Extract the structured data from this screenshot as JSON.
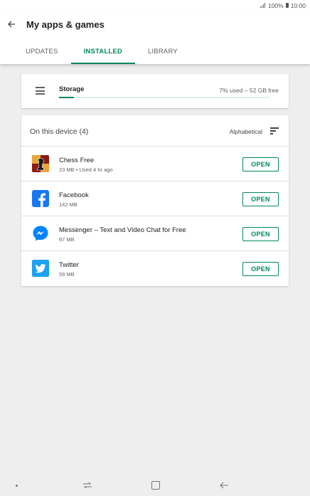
{
  "status_bar": {
    "battery": "100%",
    "time": "10:00"
  },
  "header": {
    "title": "My apps & games",
    "tabs": [
      {
        "label": "UPDATES",
        "active": false
      },
      {
        "label": "INSTALLED",
        "active": true
      },
      {
        "label": "LIBRARY",
        "active": false
      }
    ]
  },
  "storage": {
    "label": "Storage",
    "usage_text": "7% used – 52 GB free",
    "used_fraction": 0.07
  },
  "device": {
    "title": "On this device (4)",
    "sort_label": "Alphabetical",
    "apps": [
      {
        "name": "Chess Free",
        "meta": "23 MB • Used 4 hr ago",
        "button": "OPEN",
        "icon": "chess-free-app-icon"
      },
      {
        "name": "Facebook",
        "meta": "142 MB",
        "button": "OPEN",
        "icon": "facebook-app-icon"
      },
      {
        "name": "Messenger – Text and Video Chat for Free",
        "meta": "97 MB",
        "button": "OPEN",
        "icon": "messenger-app-icon"
      },
      {
        "name": "Twitter",
        "meta": "59 MB",
        "button": "OPEN",
        "icon": "twitter-app-icon"
      }
    ]
  },
  "colors": {
    "accent": "#01875f",
    "facebook": "#1877f2",
    "messenger": "#0084ff",
    "twitter": "#1da1f2"
  }
}
